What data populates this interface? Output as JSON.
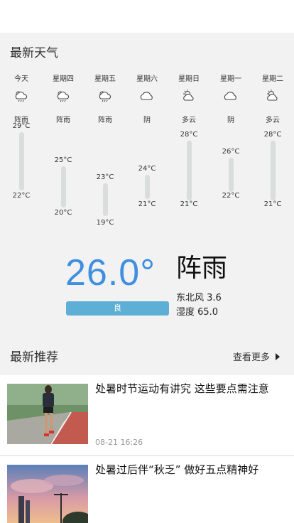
{
  "weather": {
    "section_title": "最新天气",
    "days": [
      {
        "name": "今天",
        "condition": "阵雨",
        "high": "29°C",
        "low": "22°C",
        "icon": "shower-rain-icon"
      },
      {
        "name": "星期四",
        "condition": "阵雨",
        "high": "25°C",
        "low": "20°C",
        "icon": "shower-rain-icon"
      },
      {
        "name": "星期五",
        "condition": "阵雨",
        "high": "23°C",
        "low": "19°C",
        "icon": "shower-rain-icon"
      },
      {
        "name": "星期六",
        "condition": "阴",
        "high": "24°C",
        "low": "21°C",
        "icon": "overcast-icon"
      },
      {
        "name": "星期日",
        "condition": "多云",
        "high": "28°C",
        "low": "21°C",
        "icon": "partly-cloudy-icon"
      },
      {
        "name": "星期一",
        "condition": "阴",
        "high": "26°C",
        "low": "22°C",
        "icon": "overcast-icon"
      },
      {
        "name": "星期二",
        "condition": "多云",
        "high": "28°C",
        "low": "21°C",
        "icon": "partly-cloudy-icon"
      }
    ],
    "current": {
      "temperature": "26.0°",
      "condition": "阵雨",
      "aqi": "良",
      "wind": "东北风 3.6",
      "humidity": "湿度 65.0"
    },
    "colors": {
      "temp": "#3f8fe0",
      "aqi_bg": "#5eafd6",
      "bar": "#d9dddb"
    }
  },
  "recommend": {
    "title": "最新推荐",
    "more_label": "查看更多",
    "items": [
      {
        "title": "处暑时节运动有讲究 这些要点需注意",
        "time": "08-21 16:26"
      },
      {
        "title": "处暑过后伴“秋乏” 做好五点精神好",
        "time": ""
      }
    ]
  }
}
